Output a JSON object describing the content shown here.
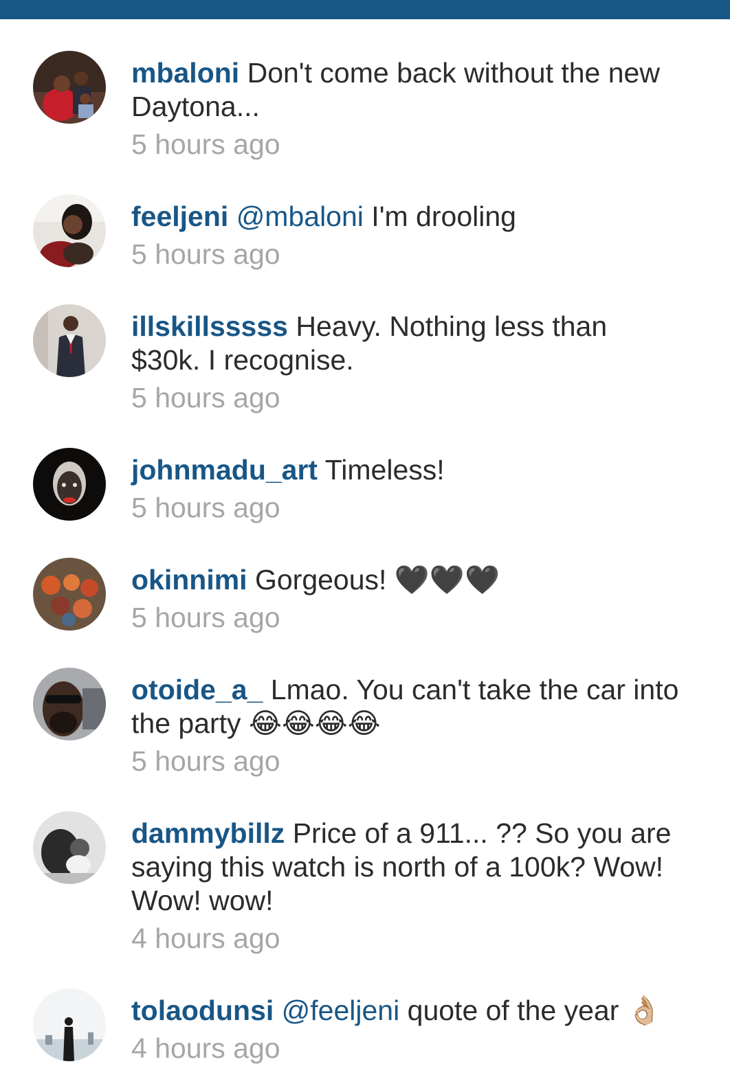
{
  "colors": {
    "top_bar": "#185686",
    "username": "#185686",
    "comment_text": "#2b2b2b",
    "timestamp": "#a6a6a6"
  },
  "comments": [
    {
      "username": "mbaloni",
      "mention": "",
      "text": "Don't come back without the new Daytona...",
      "emoji": "",
      "time": "5 hours ago"
    },
    {
      "username": "feeljeni",
      "mention": "@mbaloni",
      "text": "I'm drooling",
      "emoji": "",
      "time": "5 hours ago"
    },
    {
      "username": "illskillsssss",
      "mention": "",
      "text": "Heavy. Nothing less than $30k. I recognise.",
      "emoji": "",
      "time": "5 hours ago"
    },
    {
      "username": "johnmadu_art",
      "mention": "",
      "text": "Timeless!",
      "emoji": "",
      "time": "5 hours ago"
    },
    {
      "username": "okinnimi",
      "mention": "",
      "text": "Gorgeous!",
      "emoji": "🖤🖤🖤",
      "time": "5 hours ago"
    },
    {
      "username": "otoide_a_",
      "mention": "",
      "text": "Lmao. You can't take the car into the party",
      "emoji": "😂😂😂😂",
      "time": "5 hours ago"
    },
    {
      "username": "dammybillz",
      "mention": "",
      "text": "Price of a 911... ?? So you are saying this watch is north of a 100k? Wow! Wow! wow!",
      "emoji": "",
      "time": "4 hours ago"
    },
    {
      "username": "tolaodunsi",
      "mention": "@feeljeni",
      "text": "quote of the year",
      "emoji": "👌🏼",
      "time": "4 hours ago"
    }
  ]
}
